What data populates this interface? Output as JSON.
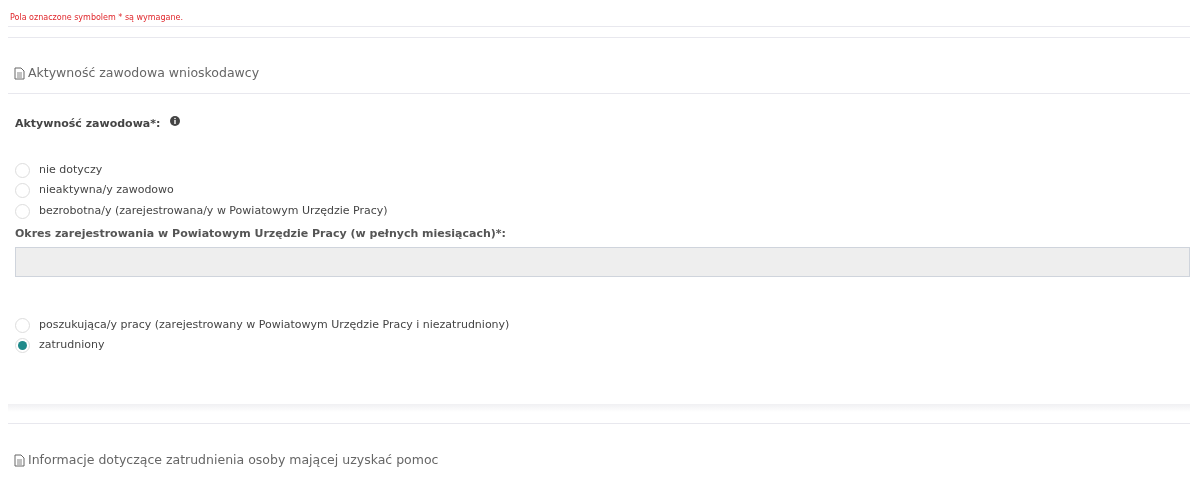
{
  "required_note": "Pola oznaczone symbolem * są wymagane.",
  "sections": [
    {
      "title": "Aktywność zawodowa wnioskodawcy",
      "question": "Aktywność zawodowa*:",
      "options": [
        {
          "label": "nie dotyczy",
          "selected": false
        },
        {
          "label": "nieaktywna/y zawodowo",
          "selected": false
        },
        {
          "label": "bezrobotna/y (zarejestrowana/y w Powiatowym Urzędzie Pracy)",
          "selected": false,
          "field": {
            "label": "Okres zarejestrowania w Powiatowym Urzędzie Pracy (w pełnych miesiącach)*:",
            "disabled": true
          }
        },
        {
          "label": "poszukująca/y pracy (zarejestrowany w Powiatowym Urzędzie Pracy i niezatrudniony)",
          "selected": false
        },
        {
          "label": "zatrudniony",
          "selected": true
        }
      ]
    },
    {
      "title": "Informacje dotyczące zatrudnienia osoby mającej uzyskać pomoc"
    }
  ]
}
